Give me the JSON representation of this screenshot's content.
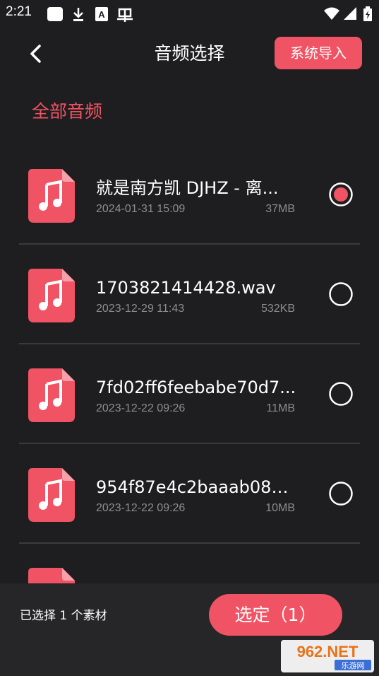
{
  "status_bar": {
    "time": "2:21"
  },
  "header": {
    "title": "音频选择",
    "import_label": "系统导入"
  },
  "section": {
    "label": "全部音频"
  },
  "files": [
    {
      "name": "就是南方凯 DJHZ - 离...",
      "date": "2024-01-31 15:09",
      "size": "37MB",
      "selected": true
    },
    {
      "name": "1703821414428.wav",
      "date": "2023-12-29 11:43",
      "size": "532KB",
      "selected": false
    },
    {
      "name": "7fd02ff6feebabe70d7...",
      "date": "2023-12-22 09:26",
      "size": "11MB",
      "selected": false
    },
    {
      "name": "954f87e4c2baaab08a...",
      "date": "2023-12-22 09:26",
      "size": "10MB",
      "selected": false
    },
    {
      "name": "",
      "date": "",
      "size": "",
      "selected": false
    }
  ],
  "footer": {
    "selected_text": "已选择 1 个素材",
    "confirm_label": "选定（1）"
  },
  "watermark": {
    "main": "962.NET",
    "sub": "乐游网"
  },
  "colors": {
    "accent": "#f05363",
    "background": "#1e1e20"
  }
}
